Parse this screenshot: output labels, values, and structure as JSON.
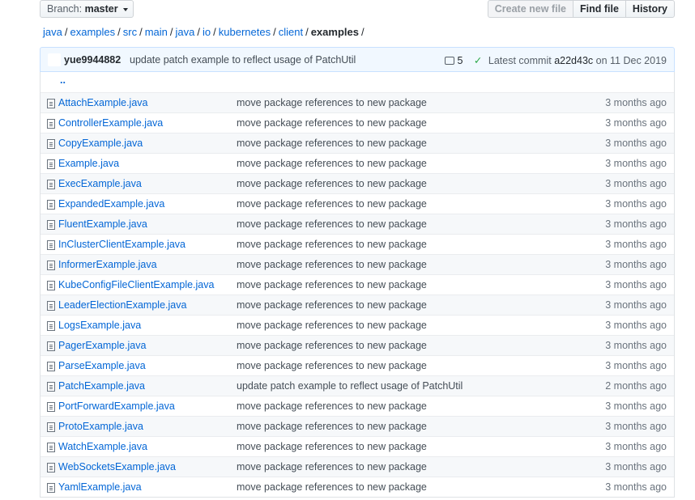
{
  "toolbar": {
    "branch_label": "Branch:",
    "branch_name": "master",
    "create_new_file": "Create new file",
    "find_file": "Find file",
    "history": "History"
  },
  "breadcrumb": {
    "parts": [
      "java",
      "examples",
      "src",
      "main",
      "java",
      "io",
      "kubernetes",
      "client"
    ],
    "current": "examples"
  },
  "commit": {
    "author": "yue9944882",
    "message": "update patch example to reflect usage of PatchUtil",
    "comment_count": "5",
    "latest_label": "Latest commit",
    "sha": "a22d43c",
    "on_label": "on",
    "date": "11 Dec 2019"
  },
  "parent_dir": "..",
  "files": [
    {
      "name": "AttachExample.java",
      "message": "move package references to new package",
      "age": "3 months ago"
    },
    {
      "name": "ControllerExample.java",
      "message": "move package references to new package",
      "age": "3 months ago"
    },
    {
      "name": "CopyExample.java",
      "message": "move package references to new package",
      "age": "3 months ago"
    },
    {
      "name": "Example.java",
      "message": "move package references to new package",
      "age": "3 months ago"
    },
    {
      "name": "ExecExample.java",
      "message": "move package references to new package",
      "age": "3 months ago"
    },
    {
      "name": "ExpandedExample.java",
      "message": "move package references to new package",
      "age": "3 months ago"
    },
    {
      "name": "FluentExample.java",
      "message": "move package references to new package",
      "age": "3 months ago"
    },
    {
      "name": "InClusterClientExample.java",
      "message": "move package references to new package",
      "age": "3 months ago"
    },
    {
      "name": "InformerExample.java",
      "message": "move package references to new package",
      "age": "3 months ago"
    },
    {
      "name": "KubeConfigFileClientExample.java",
      "message": "move package references to new package",
      "age": "3 months ago"
    },
    {
      "name": "LeaderElectionExample.java",
      "message": "move package references to new package",
      "age": "3 months ago"
    },
    {
      "name": "LogsExample.java",
      "message": "move package references to new package",
      "age": "3 months ago"
    },
    {
      "name": "PagerExample.java",
      "message": "move package references to new package",
      "age": "3 months ago"
    },
    {
      "name": "ParseExample.java",
      "message": "move package references to new package",
      "age": "3 months ago"
    },
    {
      "name": "PatchExample.java",
      "message": "update patch example to reflect usage of PatchUtil",
      "age": "2 months ago"
    },
    {
      "name": "PortForwardExample.java",
      "message": "move package references to new package",
      "age": "3 months ago"
    },
    {
      "name": "ProtoExample.java",
      "message": "move package references to new package",
      "age": "3 months ago"
    },
    {
      "name": "WatchExample.java",
      "message": "move package references to new package",
      "age": "3 months ago"
    },
    {
      "name": "WebSocketsExample.java",
      "message": "move package references to new package",
      "age": "3 months ago"
    },
    {
      "name": "YamlExample.java",
      "message": "move package references to new package",
      "age": "3 months ago"
    }
  ]
}
